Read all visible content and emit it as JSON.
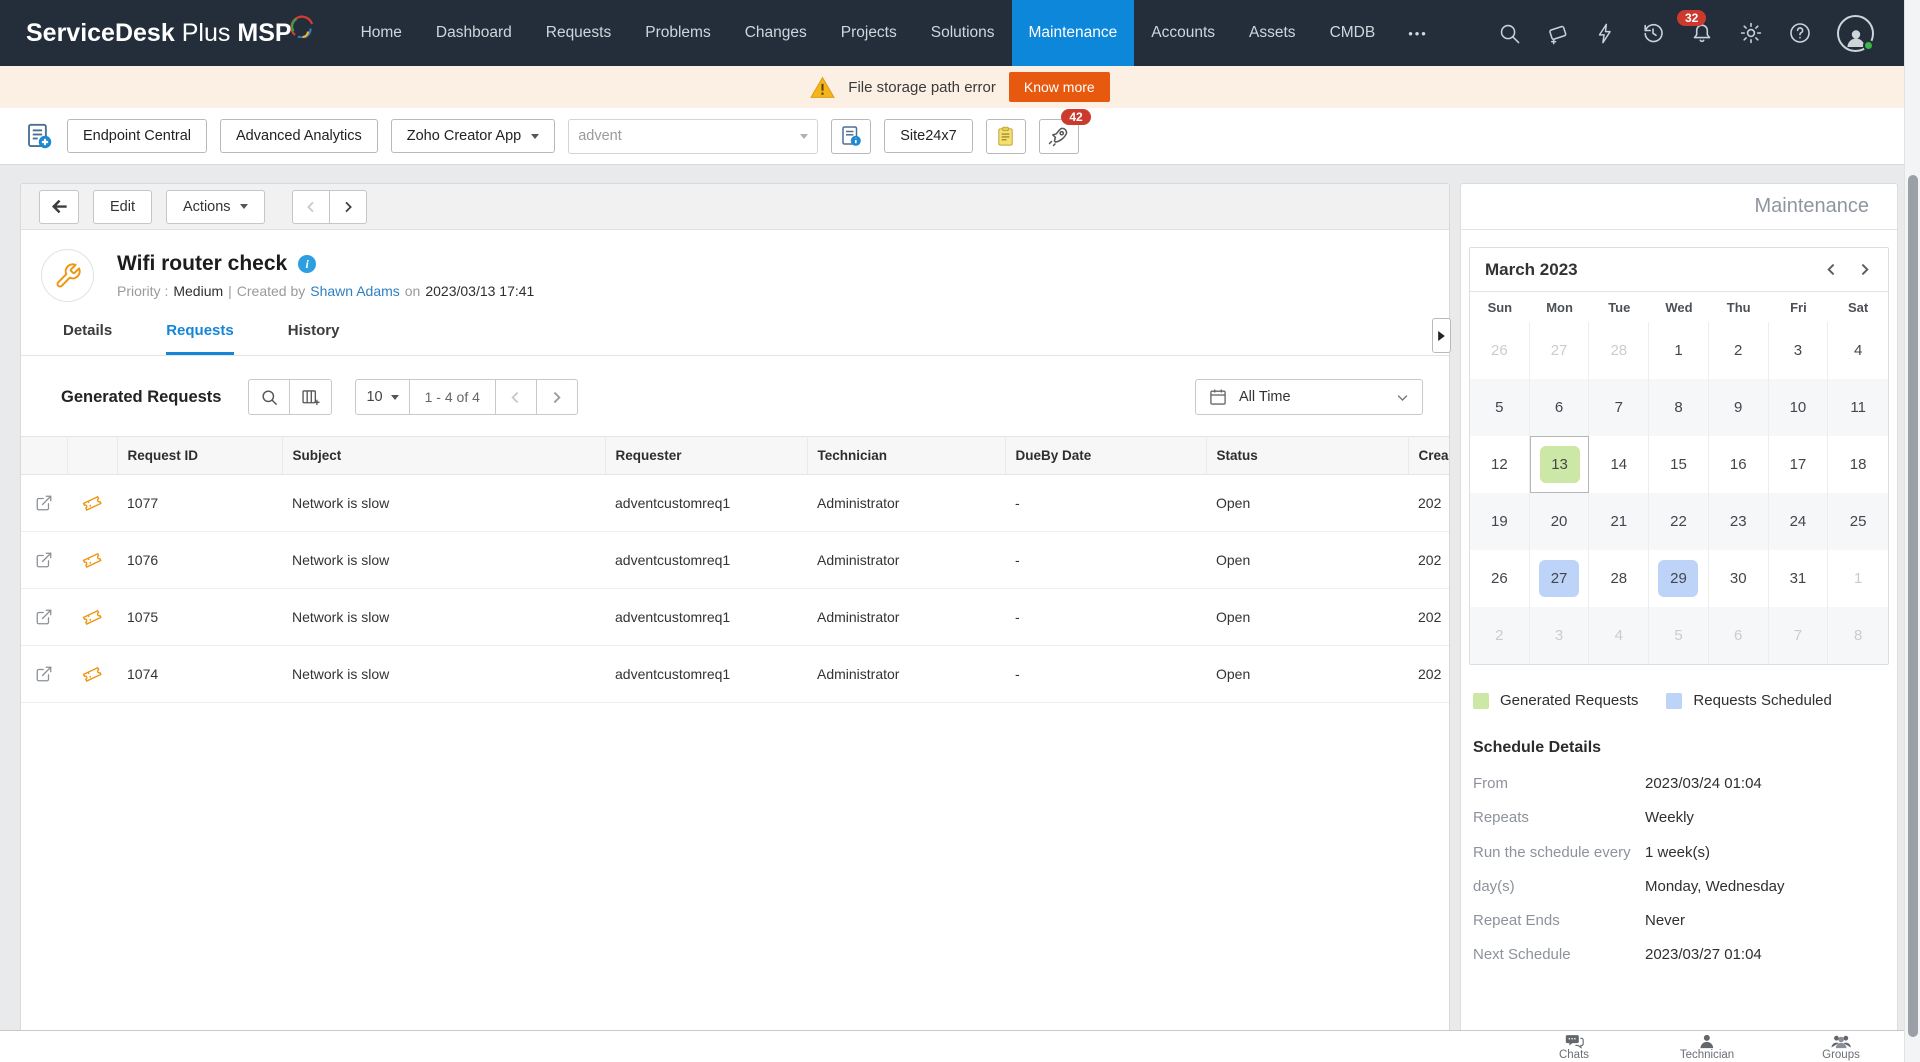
{
  "colors": {
    "accent_blue": "#0d87da",
    "link_blue": "#2d7fc1",
    "banner_orange": "#e7590f",
    "generated_green": "#cde8a6",
    "scheduled_blue": "#bed3f8"
  },
  "navbar": {
    "logo_bold": "ServiceDesk",
    "logo_light": "Plus",
    "logo_suffix": "MSP",
    "items": [
      {
        "label": "Home",
        "active": false
      },
      {
        "label": "Dashboard",
        "active": false
      },
      {
        "label": "Requests",
        "active": false
      },
      {
        "label": "Problems",
        "active": false
      },
      {
        "label": "Changes",
        "active": false
      },
      {
        "label": "Projects",
        "active": false
      },
      {
        "label": "Solutions",
        "active": false
      },
      {
        "label": "Maintenance",
        "active": true
      },
      {
        "label": "Accounts",
        "active": false
      },
      {
        "label": "Assets",
        "active": false
      },
      {
        "label": "CMDB",
        "active": false
      }
    ],
    "more": "•••",
    "notification_badge": "32"
  },
  "banner": {
    "message": "File storage path error",
    "action": "Know more"
  },
  "toolbar": {
    "endpoint_central": "Endpoint Central",
    "advanced_analytics": "Advanced Analytics",
    "zoho_creator": "Zoho Creator App",
    "search_value": "advent",
    "site24x7": "Site24x7",
    "megaphone_badge": "42"
  },
  "detail": {
    "edit": "Edit",
    "actions": "Actions",
    "title": "Wifi router check",
    "priority_label": "Priority :",
    "priority": "Medium",
    "separator": "|",
    "created_by_label": "Created by",
    "created_by": "Shawn Adams",
    "on_label": "on",
    "created_on": "2023/03/13 17:41",
    "tabs": [
      {
        "label": "Details",
        "active": false
      },
      {
        "label": "Requests",
        "active": true
      },
      {
        "label": "History",
        "active": false
      }
    ]
  },
  "requests": {
    "heading": "Generated Requests",
    "page_size": "10",
    "range": "1 - 4 of 4",
    "filter": "All Time",
    "columns": [
      "Request ID",
      "Subject",
      "Requester",
      "Technician",
      "DueBy Date",
      "Status",
      "Crea"
    ],
    "rows": [
      {
        "id": "1077",
        "subject": "Network is slow",
        "requester": "adventcustomreq1",
        "technician": "Administrator",
        "dueby": "-",
        "status": "Open",
        "created": "202"
      },
      {
        "id": "1076",
        "subject": "Network is slow",
        "requester": "adventcustomreq1",
        "technician": "Administrator",
        "dueby": "-",
        "status": "Open",
        "created": "202"
      },
      {
        "id": "1075",
        "subject": "Network is slow",
        "requester": "adventcustomreq1",
        "technician": "Administrator",
        "dueby": "-",
        "status": "Open",
        "created": "202"
      },
      {
        "id": "1074",
        "subject": "Network is slow",
        "requester": "adventcustomreq1",
        "technician": "Administrator",
        "dueby": "-",
        "status": "Open",
        "created": "202"
      }
    ]
  },
  "sidebar": {
    "title": "Maintenance",
    "calendar": {
      "month": "March 2023",
      "weekdays": [
        "Sun",
        "Mon",
        "Tue",
        "Wed",
        "Thu",
        "Fri",
        "Sat"
      ],
      "weeks": [
        [
          {
            "d": "26",
            "out": true
          },
          {
            "d": "27",
            "out": true
          },
          {
            "d": "28",
            "out": true
          },
          {
            "d": "1"
          },
          {
            "d": "2"
          },
          {
            "d": "3"
          },
          {
            "d": "4"
          }
        ],
        [
          {
            "d": "5"
          },
          {
            "d": "6"
          },
          {
            "d": "7"
          },
          {
            "d": "8"
          },
          {
            "d": "9"
          },
          {
            "d": "10"
          },
          {
            "d": "11"
          }
        ],
        [
          {
            "d": "12"
          },
          {
            "d": "13",
            "hl": "generated",
            "selected": true
          },
          {
            "d": "14"
          },
          {
            "d": "15"
          },
          {
            "d": "16"
          },
          {
            "d": "17"
          },
          {
            "d": "18"
          }
        ],
        [
          {
            "d": "19"
          },
          {
            "d": "20"
          },
          {
            "d": "21"
          },
          {
            "d": "22"
          },
          {
            "d": "23"
          },
          {
            "d": "24"
          },
          {
            "d": "25"
          }
        ],
        [
          {
            "d": "26"
          },
          {
            "d": "27",
            "hl": "scheduled"
          },
          {
            "d": "28"
          },
          {
            "d": "29",
            "hl": "scheduled"
          },
          {
            "d": "30"
          },
          {
            "d": "31"
          },
          {
            "d": "1",
            "out": true
          }
        ],
        [
          {
            "d": "2",
            "out": true
          },
          {
            "d": "3",
            "out": true
          },
          {
            "d": "4",
            "out": true
          },
          {
            "d": "5",
            "out": true
          },
          {
            "d": "6",
            "out": true
          },
          {
            "d": "7",
            "out": true
          },
          {
            "d": "8",
            "out": true
          }
        ]
      ]
    },
    "legend": [
      {
        "label": "Generated Requests",
        "color": "#cde8a6"
      },
      {
        "label": "Requests Scheduled",
        "color": "#bed3f8"
      }
    ],
    "schedule": {
      "heading": "Schedule Details",
      "rows": [
        {
          "label": "From",
          "value": "2023/03/24 01:04"
        },
        {
          "label": "Repeats",
          "value": "Weekly"
        },
        {
          "label": "Run the schedule every",
          "value": "1 week(s)"
        },
        {
          "label": "day(s)",
          "value": "Monday, Wednesday"
        },
        {
          "label": "Repeat Ends",
          "value": "Never"
        },
        {
          "label": "Next Schedule",
          "value": "2023/03/27 01:04"
        }
      ]
    }
  },
  "bottombar": {
    "items": [
      "Chats",
      "Technician",
      "Groups"
    ]
  }
}
